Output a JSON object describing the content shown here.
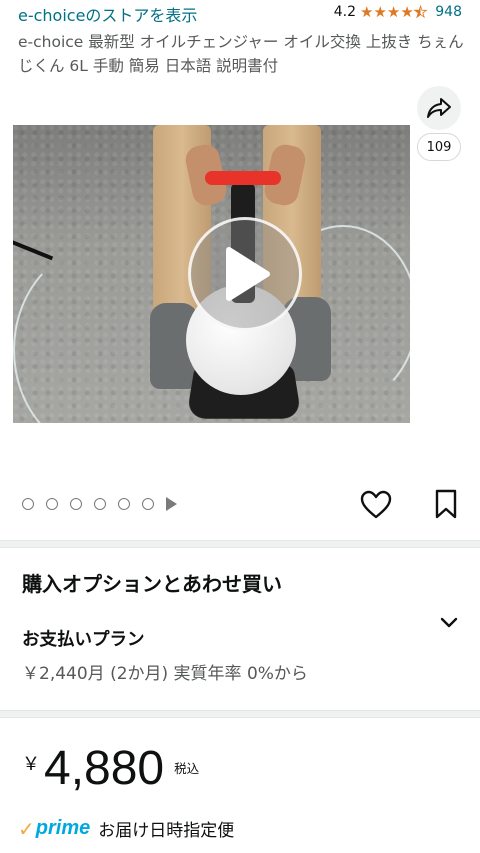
{
  "header": {
    "store_link": "e-choiceのストアを表示",
    "rating_value": "4.2",
    "rating_stars": 4.2,
    "rating_count": "948",
    "star_color": "#de7921"
  },
  "product": {
    "title": "e-choice 最新型 オイルチェンジャー オイル交換 上抜き ちぇんじくん 6L 手動 簡易 日本語 説明書付"
  },
  "media": {
    "share_icon": "share-icon",
    "share_count": "109",
    "play_icon": "play-icon",
    "image_count": 6,
    "wishlist_icon": "heart-icon",
    "save_icon": "bookmark-icon"
  },
  "purchase_options": {
    "title": "購入オプションとあわせ買い",
    "payment_plan_title": "お支払いプラン",
    "payment_plan_detail": "￥2,440月 (2か月) 実質年率 0%から",
    "chevron_icon": "chevron-down-icon"
  },
  "price": {
    "symbol": "￥",
    "value": "4,880",
    "tax_label": "税込"
  },
  "delivery": {
    "prime_check": "✓",
    "prime_label": "prime",
    "text": "お届け日時指定便",
    "prime_color": "#00a8e1",
    "check_color": "#f3a847"
  }
}
